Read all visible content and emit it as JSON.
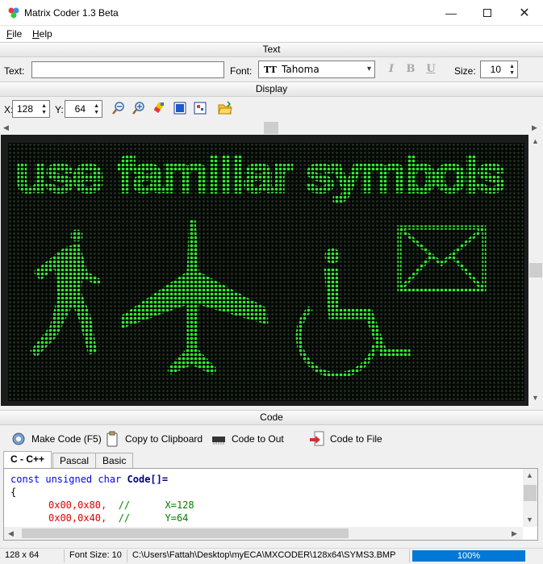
{
  "window": {
    "title": "Matrix Coder 1.3 Beta"
  },
  "menu": [
    {
      "label": "File",
      "key": "F",
      "rest": "ile"
    },
    {
      "label": "Help",
      "key": "H",
      "rest": "elp"
    }
  ],
  "sections": {
    "text": "Text",
    "display": "Display",
    "code": "Code"
  },
  "text_toolbar": {
    "text_label": "Text:",
    "text_value": "",
    "font_label": "Font:",
    "font_icon": "TT",
    "font_value": "Tahoma",
    "italic": "I",
    "bold": "B",
    "underline": "U",
    "size_label": "Size:",
    "size_value": "10"
  },
  "display_toolbar": {
    "x_label": "X:",
    "x_value": "128",
    "y_label": "Y:",
    "y_value": "64"
  },
  "led": {
    "text": "use familiar symbols",
    "color": "#33ee33",
    "off_color": "#2a3a2a",
    "icons": [
      "walking-man-icon",
      "airplane-icon",
      "wheelchair-icon",
      "envelope-icon"
    ]
  },
  "code_toolbar": {
    "make_code": "Make Code (F5)",
    "copy": "Copy to Clipboard",
    "code_out": "Code to Out",
    "code_file": "Code to File"
  },
  "tabs": [
    {
      "label": "C - C++",
      "active": true
    },
    {
      "label": "Pascal",
      "active": false
    },
    {
      "label": "Basic",
      "active": false
    }
  ],
  "code": {
    "line1_kw": "const unsigned char",
    "line1_name": "Code[]=",
    "line2": "{",
    "line3_num": "0x00,0x80,",
    "line3_cm": "//      X=128",
    "line4_num": "0x00,0x40,",
    "line4_cm": "//      Y=64"
  },
  "status": {
    "size": "128 x 64",
    "font_size": "Font Size: 10",
    "path": "C:\\Users\\Fattah\\Desktop\\myECA\\MXCODER\\128x64\\SYMS3.BMP",
    "zoom": "100%"
  }
}
